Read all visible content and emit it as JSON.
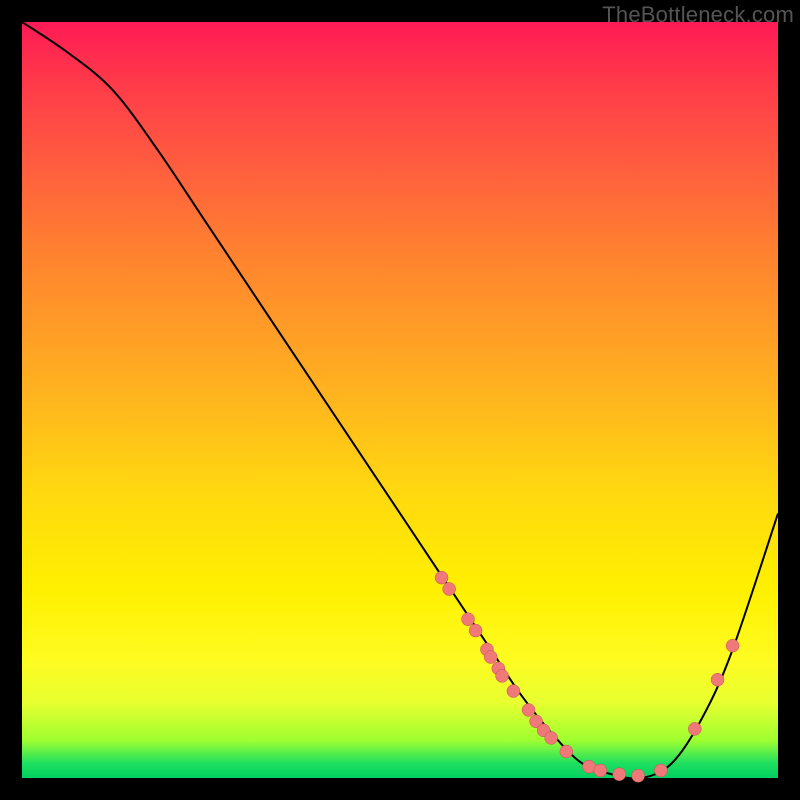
{
  "watermark": "TheBottleneck.com",
  "colors": {
    "frame": "#000000",
    "curve": "#000000",
    "dot_fill": "#f07878",
    "dot_stroke": "#bb5555"
  },
  "chart_data": {
    "type": "line",
    "title": "",
    "xlabel": "",
    "ylabel": "",
    "xlim": [
      0,
      100
    ],
    "ylim": [
      0,
      100
    ],
    "series": [
      {
        "name": "curve",
        "x": [
          0,
          6,
          12,
          18,
          24,
          30,
          36,
          42,
          48,
          54,
          58,
          62,
          66,
          70,
          74,
          78,
          82,
          86,
          90,
          94,
          100
        ],
        "values": [
          100,
          96,
          91,
          83,
          74,
          65,
          56,
          47,
          38,
          29,
          23,
          17,
          11,
          6,
          2,
          0.5,
          0,
          2,
          8,
          17,
          35
        ]
      }
    ],
    "dots": [
      {
        "x": 55.5,
        "y": 26.5
      },
      {
        "x": 56.5,
        "y": 25.0
      },
      {
        "x": 59.0,
        "y": 21.0
      },
      {
        "x": 60.0,
        "y": 19.5
      },
      {
        "x": 61.5,
        "y": 17.0
      },
      {
        "x": 62.0,
        "y": 16.0
      },
      {
        "x": 63.0,
        "y": 14.5
      },
      {
        "x": 63.5,
        "y": 13.5
      },
      {
        "x": 65.0,
        "y": 11.5
      },
      {
        "x": 67.0,
        "y": 9.0
      },
      {
        "x": 68.0,
        "y": 7.5
      },
      {
        "x": 69.0,
        "y": 6.3
      },
      {
        "x": 70.0,
        "y": 5.3
      },
      {
        "x": 72.0,
        "y": 3.5
      },
      {
        "x": 75.0,
        "y": 1.5
      },
      {
        "x": 76.5,
        "y": 1.0
      },
      {
        "x": 79.0,
        "y": 0.5
      },
      {
        "x": 81.5,
        "y": 0.3
      },
      {
        "x": 84.5,
        "y": 1.0
      },
      {
        "x": 89.0,
        "y": 6.5
      },
      {
        "x": 92.0,
        "y": 13.0
      },
      {
        "x": 94.0,
        "y": 17.5
      }
    ]
  }
}
